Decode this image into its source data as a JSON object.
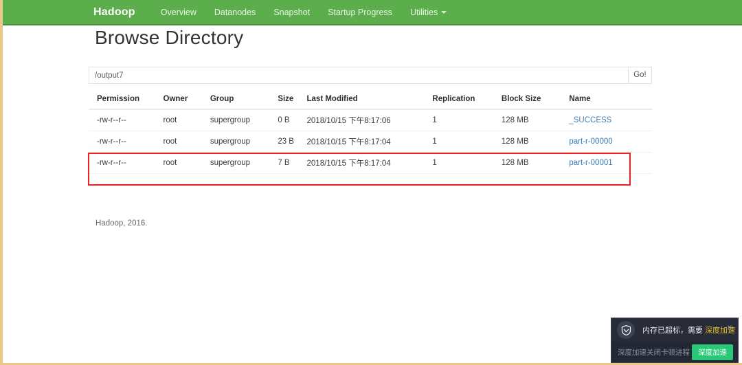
{
  "navbar": {
    "brand": "Hadoop",
    "links": [
      {
        "label": "Overview"
      },
      {
        "label": "Datanodes"
      },
      {
        "label": "Snapshot"
      },
      {
        "label": "Startup Progress"
      },
      {
        "label": "Utilities",
        "caret": true
      }
    ]
  },
  "page": {
    "title": "Browse Directory",
    "footer": "Hadoop, 2016."
  },
  "pathbar": {
    "value": "/output7",
    "placeholder": "/",
    "go_label": "Go!"
  },
  "table": {
    "headers": [
      "Permission",
      "Owner",
      "Group",
      "Size",
      "Last Modified",
      "Replication",
      "Block Size",
      "Name"
    ],
    "rows": [
      {
        "permission": "-rw-r--r--",
        "owner": "root",
        "group": "supergroup",
        "size": "0 B",
        "last_modified": "2018/10/15 下午8:17:06",
        "replication": "1",
        "block_size": "128 MB",
        "name": "_SUCCESS",
        "highlighted": false
      },
      {
        "permission": "-rw-r--r--",
        "owner": "root",
        "group": "supergroup",
        "size": "23 B",
        "last_modified": "2018/10/15 下午8:17:04",
        "replication": "1",
        "block_size": "128 MB",
        "name": "part-r-00000",
        "highlighted": true
      },
      {
        "permission": "-rw-r--r--",
        "owner": "root",
        "group": "supergroup",
        "size": "7 B",
        "last_modified": "2018/10/15 下午8:17:04",
        "replication": "1",
        "block_size": "128 MB",
        "name": "part-r-00001",
        "highlighted": true
      }
    ]
  },
  "popup": {
    "message_prefix": "内存已超标，需要 ",
    "message_accent": "深度加速",
    "subtitle": "深度加速关闭卡顿进程",
    "button_label": "深度加速",
    "close_label": "×"
  },
  "colors": {
    "navbar_green": "#5cae4c",
    "link_blue": "#337ab7",
    "annotation_red": "#ee2222",
    "popup_bg": "#272c38",
    "popup_accent": "#e8c22a",
    "popup_button_green": "#28c878"
  }
}
